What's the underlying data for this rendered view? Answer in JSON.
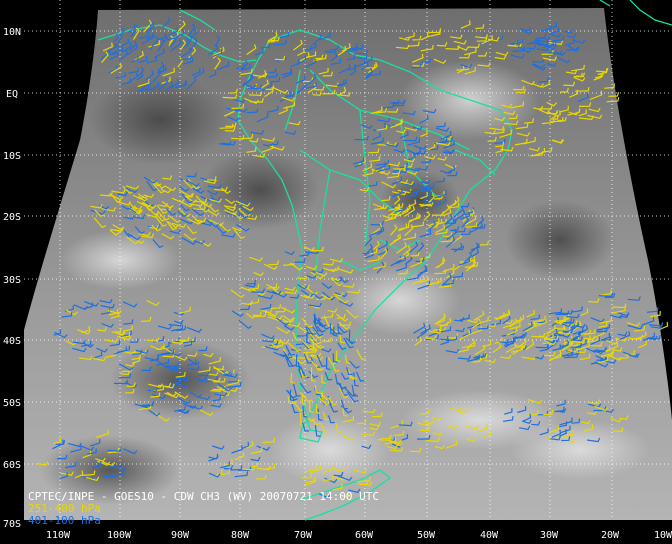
{
  "map": {
    "credit_line": "CPTEC/INPE - GOES10 - CDW CH3 (WV) 20070721 14:00 UTC",
    "latitude_labels": [
      "10N",
      "EQ",
      "10S",
      "20S",
      "30S",
      "40S",
      "50S",
      "60S",
      "70S"
    ],
    "longitude_labels": [
      "110W",
      "100W",
      "90W",
      "80W",
      "70W",
      "60W",
      "50W",
      "40W",
      "30W",
      "20W",
      "10W"
    ],
    "legend": [
      {
        "label": "251-400 hPa",
        "color": "#e8d800"
      },
      {
        "label": "401-100 hPa",
        "color": "#1e6fe0"
      }
    ],
    "colors": {
      "background": "#000000",
      "coastline": "#19e0a0",
      "grid": "#ffffff",
      "upper_winds": "#e8d800",
      "lower_winds": "#1e6fe0"
    }
  }
}
